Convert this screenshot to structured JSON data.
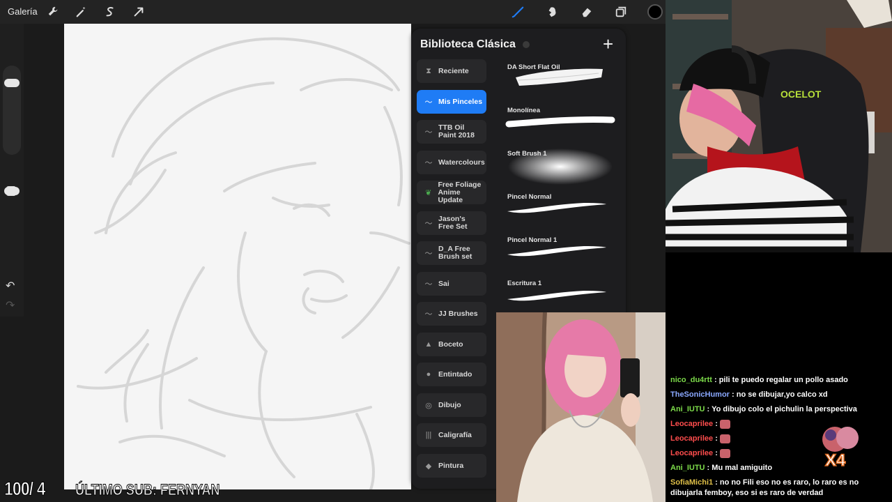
{
  "toolbar": {
    "gallery_label": "Galería",
    "left_tools": [
      "wrench-icon",
      "magic-wand-icon",
      "selection-icon",
      "transform-arrow-icon"
    ],
    "right_tools": [
      "brush-icon",
      "smudge-icon",
      "eraser-icon",
      "layers-icon",
      "color-icon"
    ],
    "active_tool_color": "#1f7cf5",
    "current_color": "#000000"
  },
  "brush_library": {
    "title": "Biblioteca Clásica",
    "add_icon": "plus-icon",
    "sets": [
      {
        "label": "Reciente",
        "icon": "hourglass-icon"
      },
      {
        "label": "Mis Pinceles",
        "icon": "brush-stroke-icon",
        "active": true
      },
      {
        "label": "TTB Oil Paint 2018",
        "icon": "brush-stroke-icon"
      },
      {
        "label": "Watercolours",
        "icon": "brush-stroke-icon"
      },
      {
        "label": "Free Foliage Anime Update",
        "icon": "leaf-icon"
      },
      {
        "label": "Jason's Free Set",
        "icon": "brush-stroke-icon"
      },
      {
        "label": "D_A Free Brush set",
        "icon": "brush-stroke-icon"
      },
      {
        "label": "Sai",
        "icon": "brush-stroke-icon"
      },
      {
        "label": "JJ Brushes",
        "icon": "brush-stroke-icon"
      },
      {
        "label": "Boceto",
        "icon": "pencil-tip-icon"
      },
      {
        "label": "Entintado",
        "icon": "ink-drop-icon"
      },
      {
        "label": "Dibujo",
        "icon": "spiral-icon"
      },
      {
        "label": "Caligrafía",
        "icon": "calligraphy-icon"
      },
      {
        "label": "Pintura",
        "icon": "paint-icon"
      }
    ],
    "brushes": [
      {
        "name": "DA Short Flat Oil"
      },
      {
        "name": "Monolínea"
      },
      {
        "name": "Soft Brush 1"
      },
      {
        "name": "Pincel Normal"
      },
      {
        "name": "Pincel Normal 1"
      },
      {
        "name": "Escritura 1"
      }
    ]
  },
  "chat": {
    "messages": [
      {
        "user": "nico_du4rtt",
        "color": "#7ddc4a",
        "text": "pili te puedo regalar un pollo asado"
      },
      {
        "user": "TheSonicHumor",
        "color": "#8aa8ff",
        "text": "no se dibujar,yo calco xd"
      },
      {
        "user": "Ani_IUTU",
        "color": "#7ddc4a",
        "text": "Yo dibujo colo el pichulin la perspectiva"
      },
      {
        "user": "Leocaprilee",
        "color": "#ff4d4d",
        "text": "",
        "emote": true
      },
      {
        "user": "Leocaprilee",
        "color": "#ff4d4d",
        "text": "",
        "emote": true
      },
      {
        "user": "Leocaprilee",
        "color": "#ff4d4d",
        "text": "",
        "emote": true
      },
      {
        "user": "Ani_IUTU",
        "color": "#7ddc4a",
        "text": "Mu mal amiguito"
      },
      {
        "user": "SofiaMichi1",
        "color": "#e0c048",
        "text": "no no Fili eso no es raro, lo raro es no dibujarla femboy, eso si es raro de verdad"
      }
    ],
    "sticker_text": "X4"
  },
  "overlay": {
    "counter": "100/ 4",
    "last_sub": "ÚLTIMO SUB: FERNYAN"
  }
}
